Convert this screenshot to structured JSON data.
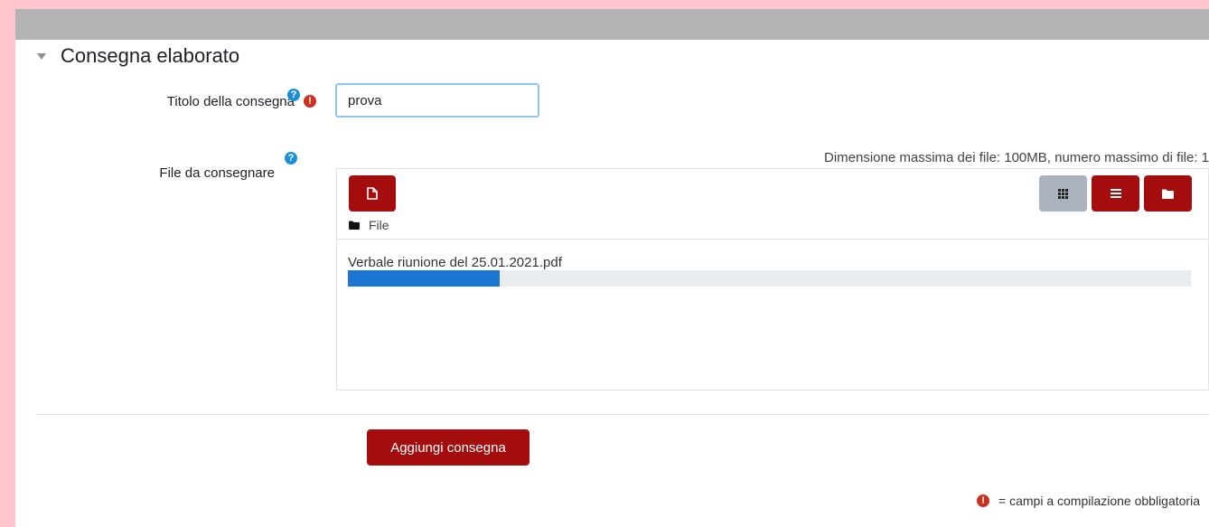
{
  "section": {
    "title": "Consegna elaborato"
  },
  "fields": {
    "title": {
      "label": "Titolo della consegna",
      "value": "prova"
    },
    "files": {
      "label": "File da consegnare"
    }
  },
  "icons": {
    "required": "exclamation-circle-icon",
    "help": "question-circle-icon"
  },
  "filepicker": {
    "limits": "Dimensione massima dei file: 100MB, numero massimo di file: 1",
    "path_label": "File",
    "upload": {
      "filename": "Verbale riunione del 25.01.2021.pdf",
      "progress_percent": 18
    },
    "views": [
      "grid",
      "list",
      "tree"
    ]
  },
  "actions": {
    "submit_label": "Aggiungi consegna"
  },
  "legend": {
    "text": "= campi a compilazione obbligatoria"
  },
  "colors": {
    "accent": "#a30d0d",
    "progress": "#1a76d1",
    "required": "#ca3120",
    "help": "#1d8ed8",
    "background": "#ffc6cd"
  }
}
